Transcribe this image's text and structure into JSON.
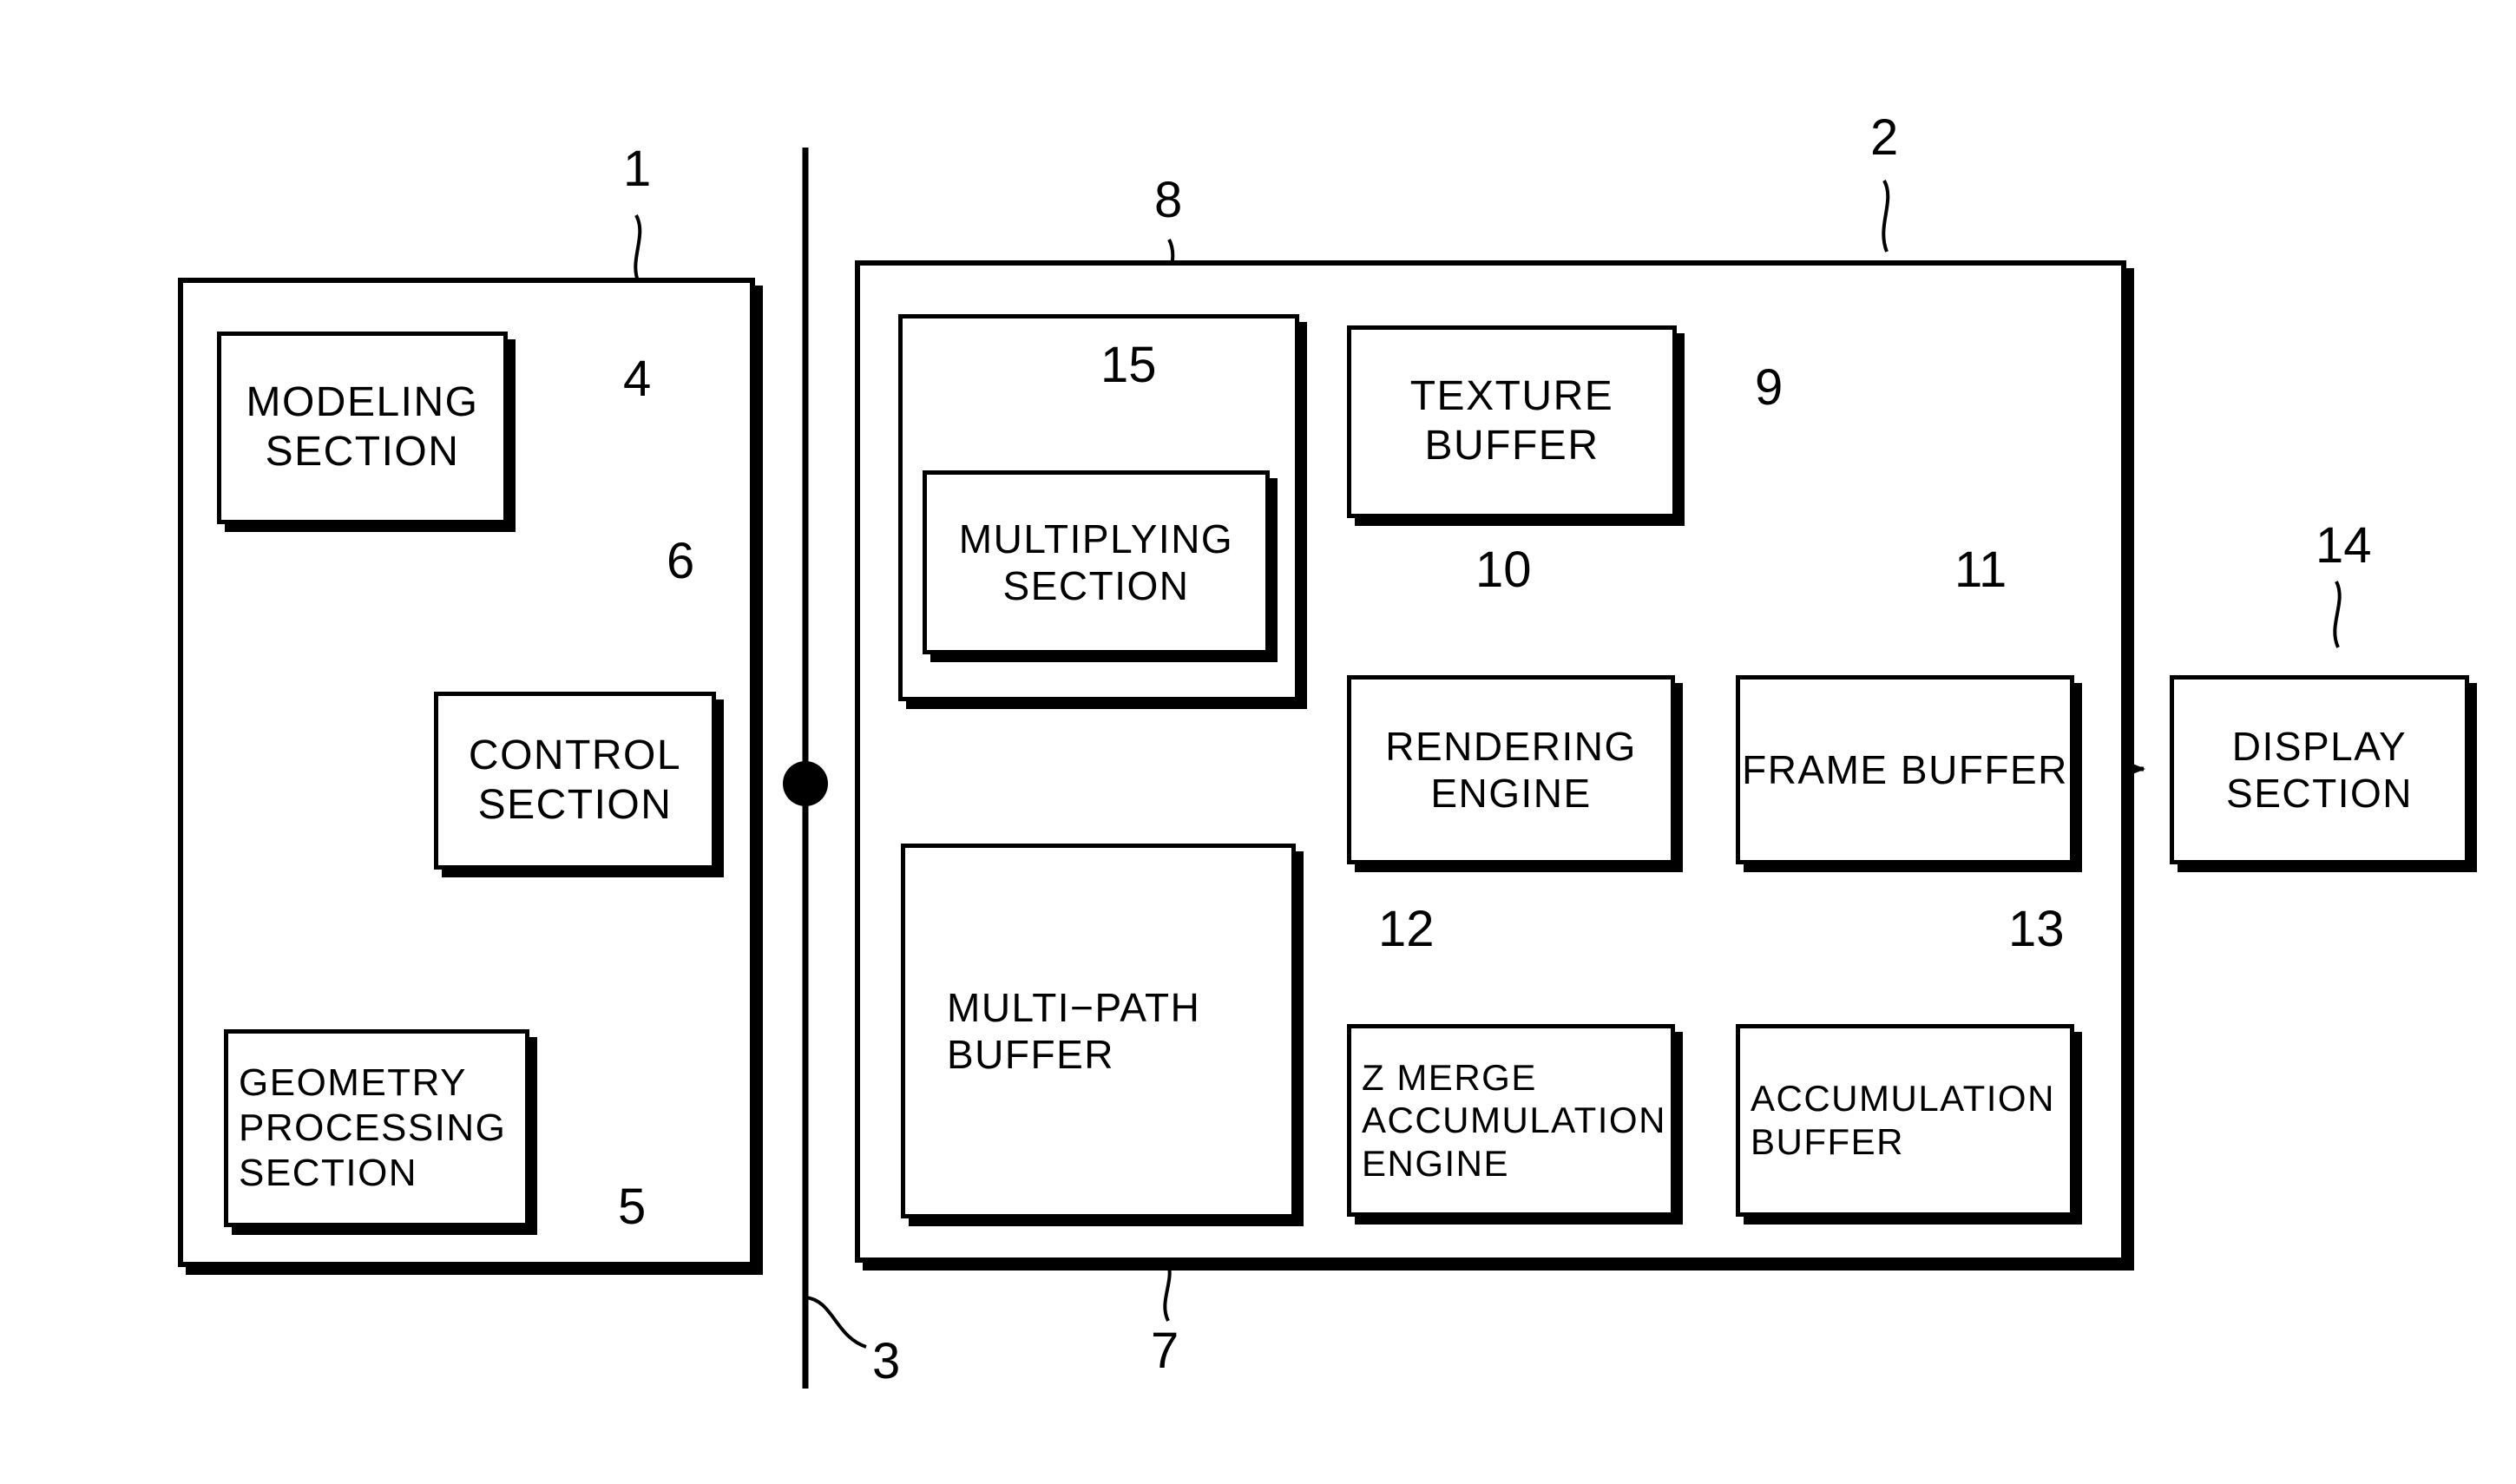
{
  "figure": {
    "type": "patent-block-diagram",
    "background": "#ffffff",
    "line_color": "#000000"
  },
  "containers": [
    {
      "id": "host",
      "ref": "1",
      "name": "host-container"
    },
    {
      "id": "graphics",
      "ref": "2",
      "name": "graphics-container"
    },
    {
      "id": "multipath_group",
      "ref": "8",
      "name": "multipath-processing-group"
    }
  ],
  "blocks": [
    {
      "id": "modeling",
      "ref": "4",
      "label": "MODELING\nSECTION"
    },
    {
      "id": "control",
      "ref": "6",
      "label": "CONTROL\nSECTION"
    },
    {
      "id": "geometry",
      "ref": "5",
      "label": "GEOMETRY\nPROCESSING\nSECTION"
    },
    {
      "id": "multiplying",
      "ref": "15",
      "label": "MULTIPLYING\nSECTION"
    },
    {
      "id": "multipath_buf",
      "ref": "7",
      "label": "MULTI−PATH\nBUFFER"
    },
    {
      "id": "texture_buf",
      "ref": "9",
      "label": "TEXTURE\nBUFFER"
    },
    {
      "id": "rendering",
      "ref": "10",
      "label": "RENDERING\nENGINE"
    },
    {
      "id": "frame_buf",
      "ref": "11",
      "label": "FRAME BUFFER"
    },
    {
      "id": "zmerge",
      "ref": "12",
      "label": "Z MERGE\nACCUMULATION\nENGINE"
    },
    {
      "id": "accum_buf",
      "ref": "13",
      "label": "ACCUMULATION\nBUFFER"
    },
    {
      "id": "display",
      "ref": "14",
      "label": "DISPLAY\nSECTION"
    }
  ],
  "bus": {
    "ref": "3",
    "name": "system-bus"
  },
  "reference_numerals": [
    {
      "ref": "1",
      "target": "host-container"
    },
    {
      "ref": "2",
      "target": "graphics-container"
    },
    {
      "ref": "3",
      "target": "system-bus"
    },
    {
      "ref": "4",
      "target": "modeling-section"
    },
    {
      "ref": "5",
      "target": "geometry-processing-section"
    },
    {
      "ref": "6",
      "target": "control-section"
    },
    {
      "ref": "7",
      "target": "multi-path-buffer"
    },
    {
      "ref": "8",
      "target": "multipath-processing-group"
    },
    {
      "ref": "9",
      "target": "texture-buffer"
    },
    {
      "ref": "10",
      "target": "rendering-engine"
    },
    {
      "ref": "11",
      "target": "frame-buffer"
    },
    {
      "ref": "12",
      "target": "z-merge-accumulation-engine"
    },
    {
      "ref": "13",
      "target": "accumulation-buffer"
    },
    {
      "ref": "14",
      "target": "display-section"
    },
    {
      "ref": "15",
      "target": "multiplying-section"
    }
  ],
  "connections": [
    {
      "from": "modeling",
      "to": "geometry",
      "arrow": "single"
    },
    {
      "from": "modeling",
      "to": "control",
      "arrow": "single"
    },
    {
      "from": "control",
      "to": "modeling",
      "arrow": "single"
    },
    {
      "from": "control",
      "to": "geometry",
      "arrow": "single"
    },
    {
      "from": "geometry",
      "to": "control",
      "arrow": "single"
    },
    {
      "from": "multiplying",
      "to": "multipath_buf",
      "arrow": "double"
    },
    {
      "from": "multipath_group",
      "to": "texture_buf",
      "arrow": "single"
    },
    {
      "from": "multipath_group",
      "to": "rendering",
      "arrow": "single"
    },
    {
      "from": "multipath_buf",
      "to": "zmerge",
      "arrow": "single"
    },
    {
      "from": "rendering",
      "to": "frame_buf",
      "arrow": "single"
    },
    {
      "from": "zmerge",
      "to": "accum_buf",
      "arrow": "single"
    },
    {
      "from": "accum_buf",
      "to": "frame_buf",
      "arrow": "single"
    },
    {
      "from": "frame_buf",
      "to": "zmerge",
      "arrow": "single"
    },
    {
      "from": "frame_buf",
      "to": "display",
      "arrow": "single"
    }
  ]
}
